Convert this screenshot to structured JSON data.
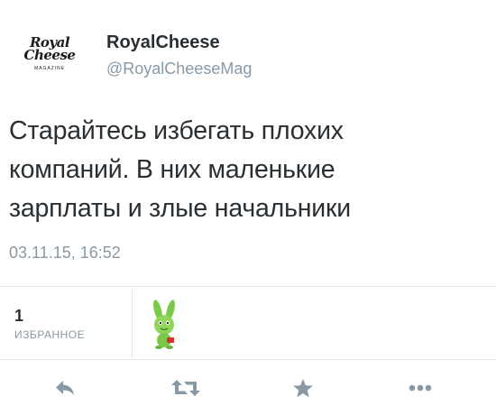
{
  "account": {
    "display_name": "RoyalCheese",
    "handle": "@RoyalCheeseMag",
    "avatar_logo": {
      "line1": "Royal",
      "line2": "Cheese",
      "line3": "MAGAZINE"
    }
  },
  "tweet": {
    "text": "Старайтесь избегать плохих\nкомпаний. В них маленькие\nзарплаты и злые начальники",
    "timestamp": "03.11.15, 16:52"
  },
  "stats": {
    "favorites_count": "1",
    "favorites_label": "ИЗБРАННОЕ"
  },
  "actions": [
    {
      "name": "reply",
      "icon": "reply-icon"
    },
    {
      "name": "retweet",
      "icon": "retweet-icon"
    },
    {
      "name": "favorite",
      "icon": "star-icon"
    },
    {
      "name": "more",
      "icon": "more-dots-icon"
    }
  ],
  "colors": {
    "text": "#292f33",
    "muted": "#8899a6",
    "divider": "#e1e8ed",
    "icon": "#8899a6"
  }
}
